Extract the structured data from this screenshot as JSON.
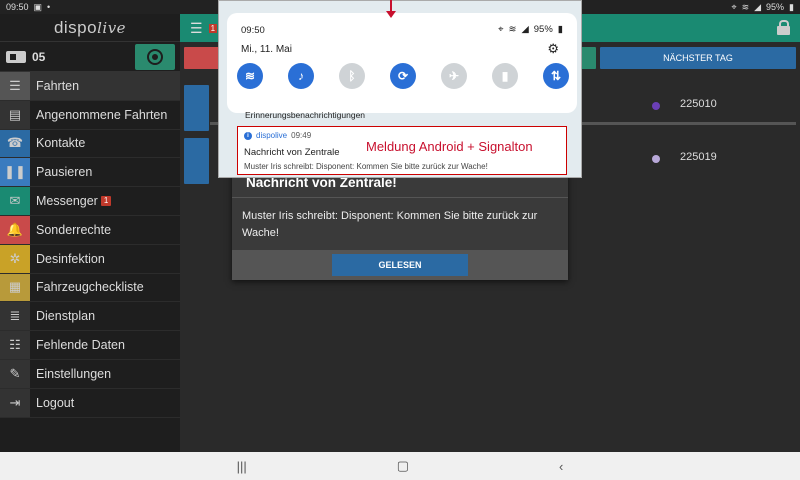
{
  "statusbar": {
    "time": "09:50",
    "battery": "95%"
  },
  "sidebar": {
    "logo_prefix": "dispo",
    "logo_suffix": "live",
    "vehicle": "05",
    "items": [
      {
        "label": "Fahrten",
        "icon": "checklist-icon",
        "color": "#555555"
      },
      {
        "label": "Angenommene Fahrten",
        "icon": "id-card-icon",
        "color": "#333333"
      },
      {
        "label": "Kontakte",
        "icon": "contacts-icon",
        "color": "#2b6aa3"
      },
      {
        "label": "Pausieren",
        "icon": "pause-icon",
        "color": "#3a7bbf"
      },
      {
        "label": "Messenger",
        "icon": "mail-icon",
        "color": "#1a8a72",
        "badge": "1"
      },
      {
        "label": "Sonderrechte",
        "icon": "bell-icon",
        "color": "#c94a4a"
      },
      {
        "label": "Desinfektion",
        "icon": "bug-icon",
        "color": "#c9a227"
      },
      {
        "label": "Fahrzeugcheckliste",
        "icon": "clipboard-icon",
        "color": "#b89a3a"
      },
      {
        "label": "Dienstplan",
        "icon": "list-icon",
        "color": "#333333"
      },
      {
        "label": "Fehlende Daten",
        "icon": "database-icon",
        "color": "#333333"
      },
      {
        "label": "Einstellungen",
        "icon": "wrench-icon",
        "color": "#333333"
      },
      {
        "label": "Logout",
        "icon": "logout-icon",
        "color": "#333333"
      }
    ]
  },
  "topbar": {
    "badge": "1"
  },
  "daybar": {
    "next_day": "NÄCHSTER TAG"
  },
  "rows": [
    {
      "number": "225010",
      "dot_color": "#6a3fb5"
    },
    {
      "number": "225019",
      "dot_color": "#b8a8d8"
    }
  ],
  "dialog": {
    "title": "Nachricht von Zentrale!",
    "body": "Muster Iris schreibt: Disponent: Kommen Sie bitte zurück zur Wache!",
    "button": "GELESEN"
  },
  "shade": {
    "time": "09:50",
    "battery": "95%",
    "date": "Mi., 11. Mai",
    "section": "Erinnerungsbenachrichtigungen",
    "notification": {
      "app": "dispolive",
      "time": "09:49",
      "title": "Nachricht von Zentrale",
      "text": "Muster Iris schreibt: Disponent: Kommen Sie bitte zurück zur Wache!",
      "callout": "Meldung Android + Signalton"
    }
  },
  "colors": {
    "accent": "#1a8a72",
    "primary": "#2b6aa3",
    "callout": "#c8102e"
  }
}
